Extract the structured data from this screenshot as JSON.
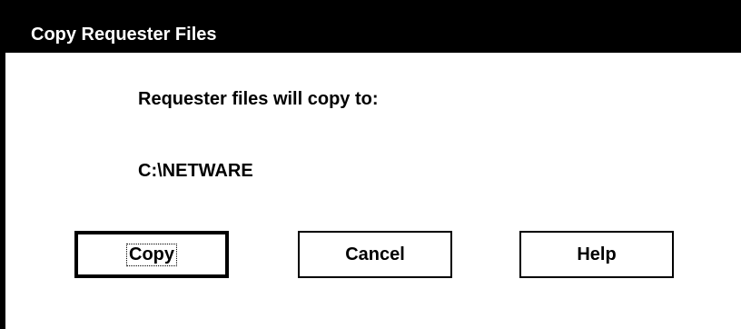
{
  "dialog": {
    "title": "Copy Requester Files",
    "message": "Requester files will copy to:",
    "path": "C:\\NETWARE"
  },
  "buttons": {
    "copy_label": "Copy",
    "cancel_label": "Cancel",
    "help_label": "Help"
  },
  "colors": {
    "title_bar": "#000000",
    "background": "#ffffff",
    "text": "#000000"
  }
}
